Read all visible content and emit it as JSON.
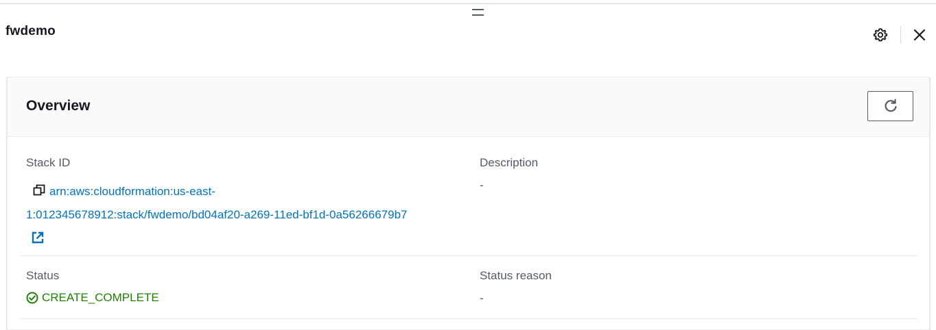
{
  "header": {
    "title": "fwdemo",
    "drag_handle_icon": "drag-handle-icon",
    "settings_icon": "gear-icon",
    "close_icon": "close-icon"
  },
  "overview": {
    "title": "Overview",
    "refresh_icon": "refresh-icon",
    "stack_id": {
      "label": "Stack ID",
      "value": "arn:aws:cloudformation:us-east-1:012345678912:stack/fwdemo/bd04af20-a269-11ed-bf1d-0a56266679b7",
      "copy_icon": "copy-icon",
      "external_link_icon": "external-link-icon"
    },
    "description": {
      "label": "Description",
      "value": "-"
    },
    "status": {
      "label": "Status",
      "value": "CREATE_COMPLETE",
      "status_icon": "check-circle-icon"
    },
    "status_reason": {
      "label": "Status reason",
      "value": "-"
    }
  },
  "colors": {
    "link": "#0073bb",
    "success": "#1d8102",
    "label": "#545b64",
    "text": "#16191f",
    "header_bg": "#fafafa",
    "border": "#eaeded"
  }
}
